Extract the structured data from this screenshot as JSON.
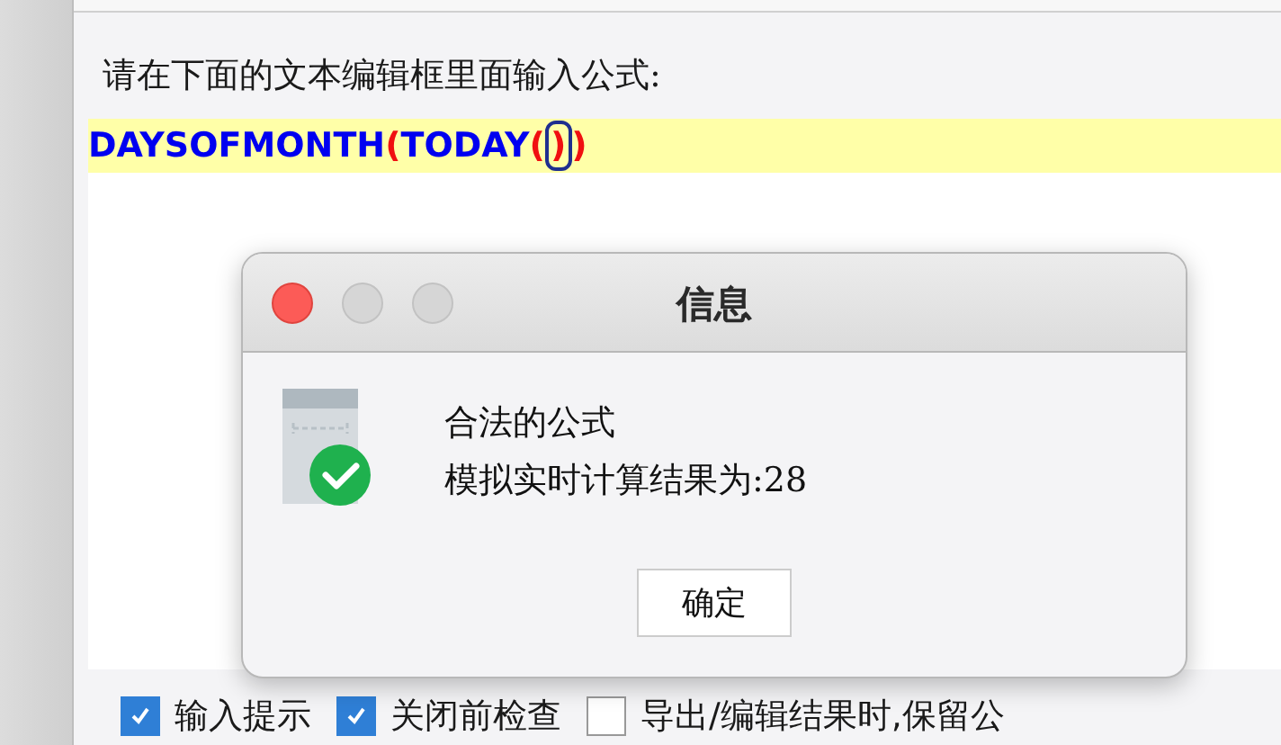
{
  "prompt": "请在下面的文本编辑框里面输入公式:",
  "formula": [
    {
      "kind": "function",
      "text": "DAYSOFMONTH",
      "highlighted": false
    },
    {
      "kind": "paren",
      "text": "(",
      "highlighted": false
    },
    {
      "kind": "function",
      "text": "TODAY",
      "highlighted": false
    },
    {
      "kind": "paren",
      "text": "(",
      "highlighted": false
    },
    {
      "kind": "paren",
      "text": ")",
      "highlighted": true
    },
    {
      "kind": "paren",
      "text": ")",
      "highlighted": false
    }
  ],
  "options": [
    {
      "label": "输入提示",
      "checked": true
    },
    {
      "label": "关闭前检查",
      "checked": true
    },
    {
      "label": "导出/编辑结果时,保留公",
      "checked": false
    }
  ],
  "dialog": {
    "title": "信息",
    "lines": [
      "合法的公式",
      "模拟实时计算结果为:28"
    ],
    "button": "确定"
  }
}
